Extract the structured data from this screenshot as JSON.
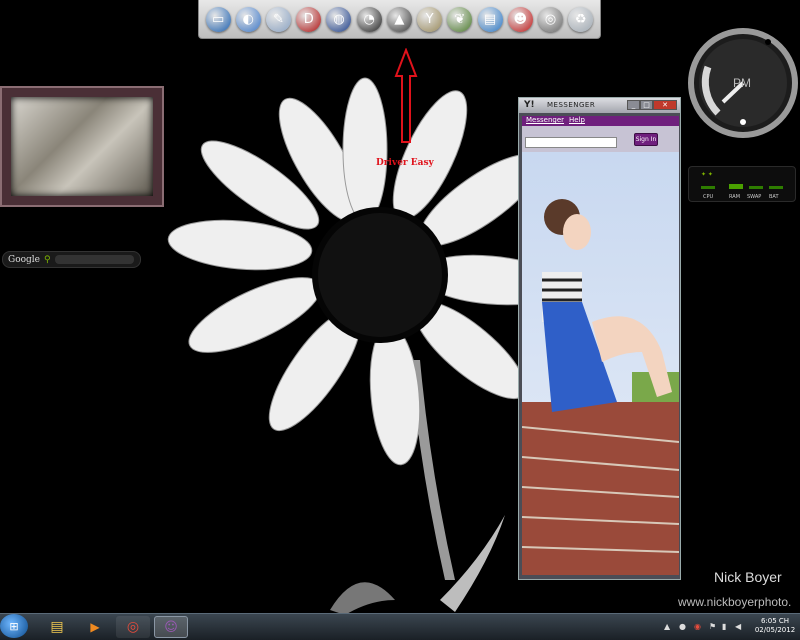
{
  "dock": {
    "icons": [
      {
        "name": "computer-icon",
        "color": "#1b5fb0",
        "glyph": "▭"
      },
      {
        "name": "network-icon",
        "color": "#3b77c9",
        "glyph": "◐"
      },
      {
        "name": "paint-icon",
        "color": "#8aa3c4",
        "glyph": "✎"
      },
      {
        "name": "red-d-icon",
        "color": "#b01010",
        "glyph": "D"
      },
      {
        "name": "globe-icon",
        "color": "#1a3d8a",
        "glyph": "◍"
      },
      {
        "name": "speed-icon",
        "color": "#222222",
        "glyph": "◔"
      },
      {
        "name": "hat-icon",
        "color": "#3a3a3a",
        "glyph": "▲"
      },
      {
        "name": "trophy-icon",
        "color": "#9a8a5a",
        "glyph": "Y"
      },
      {
        "name": "leaf-icon",
        "color": "#4a7a2a",
        "glyph": "❦"
      },
      {
        "name": "folder-icon",
        "color": "#2a78c8",
        "glyph": "▤"
      },
      {
        "name": "face-icon",
        "color": "#c01818",
        "glyph": "☻"
      },
      {
        "name": "chrome-icon",
        "color": "#6a6a6a",
        "glyph": "◎"
      },
      {
        "name": "recycle-bin-icon",
        "color": "#a0aab4",
        "glyph": "♻"
      }
    ]
  },
  "annotation": {
    "label": "Driver Easy",
    "color": "#e0121b"
  },
  "google": {
    "label": "Google"
  },
  "clock": {
    "ampm": "PM"
  },
  "meter": {
    "labels": [
      "CPU",
      "RAM",
      "SWAP",
      "BAT"
    ]
  },
  "messenger": {
    "title": "MESSENGER",
    "logo": "Y!",
    "menu": [
      "Messenger",
      "Help"
    ],
    "signin": "Sign In",
    "accent": "#6f1f7d"
  },
  "watermark": {
    "name": "Nick Boyer",
    "url": "www.nickboyerphoto."
  },
  "taskbar": {
    "time": "6:05 CH",
    "date": "02/05/2012"
  }
}
